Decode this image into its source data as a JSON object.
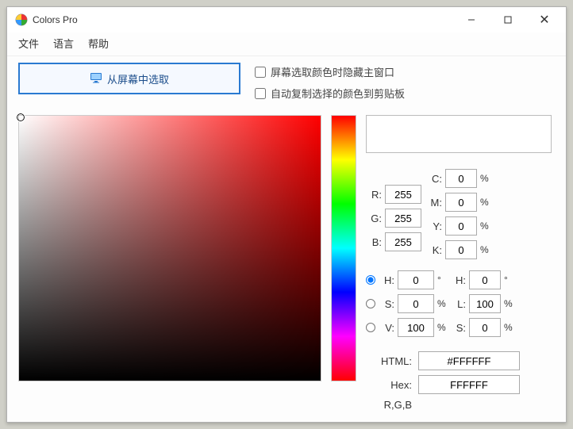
{
  "window": {
    "title": "Colors Pro"
  },
  "menu": {
    "file": "文件",
    "language": "语言",
    "help": "帮助"
  },
  "toolbar": {
    "pick_from_screen": "从屏幕中选取",
    "checkbox_hide_main": "屏幕选取颜色时隐藏主窗口",
    "checkbox_auto_copy": "自动复制选择的颜色到剪贴板"
  },
  "labels": {
    "R": "R:",
    "G": "G:",
    "B": "B:",
    "C": "C:",
    "M": "M:",
    "Y": "Y:",
    "K": "K:",
    "H": "H:",
    "S": "S:",
    "V": "V:",
    "L": "L:",
    "HTML": "HTML:",
    "Hex": "Hex:",
    "RGB": "R,G,B"
  },
  "suffixes": {
    "pct": "%",
    "deg": "°"
  },
  "values": {
    "R": "255",
    "G": "255",
    "B": "255",
    "C": "0",
    "M": "0",
    "Y": "0",
    "K": "0",
    "HSV_H": "0",
    "HSV_S": "0",
    "HSV_V": "100",
    "HSL_H": "0",
    "HSL_L": "100",
    "HSL_S": "0",
    "HTML": "#FFFFFF",
    "Hex": "FFFFFF"
  },
  "colors": {
    "preview": "#FFFFFF"
  }
}
